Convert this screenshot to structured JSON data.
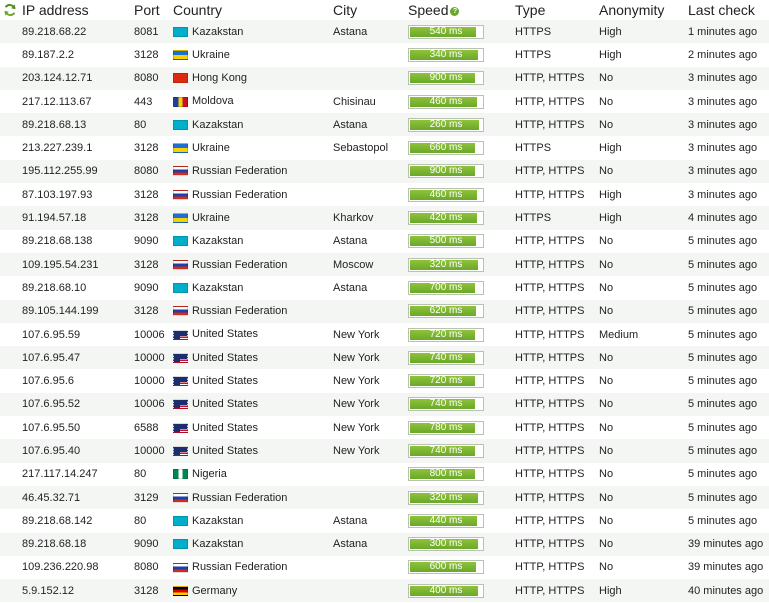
{
  "headers": {
    "ip": "IP address",
    "port": "Port",
    "country": "Country",
    "city": "City",
    "speed": "Speed",
    "type": "Type",
    "anonymity": "Anonymity",
    "last_check": "Last check"
  },
  "colors": {
    "speed_fill": "#6aa82a",
    "speed_border": "#b9c1b3",
    "row_alt": "#f4f6f4"
  },
  "rows": [
    {
      "ip": "89.218.68.22",
      "port": "8081",
      "country": "Kazakstan",
      "flag": "kz",
      "city": "Astana",
      "speed": "540 ms",
      "speed_ratio": 0.92,
      "type": "HTTPS",
      "anonymity": "High",
      "last_check": "1 minutes ago"
    },
    {
      "ip": "89.187.2.2",
      "port": "3128",
      "country": "Ukraine",
      "flag": "ua",
      "city": "",
      "speed": "340 ms",
      "speed_ratio": 0.95,
      "type": "HTTPS",
      "anonymity": "High",
      "last_check": "2 minutes ago"
    },
    {
      "ip": "203.124.12.71",
      "port": "8080",
      "country": "Hong Kong",
      "flag": "hk",
      "city": "",
      "speed": "900 ms",
      "speed_ratio": 0.9,
      "type": "HTTP, HTTPS",
      "anonymity": "No",
      "last_check": "3 minutes ago"
    },
    {
      "ip": "217.12.113.67",
      "port": "443",
      "country": "Moldova",
      "flag": "md",
      "city": "Chisinau",
      "speed": "460 ms",
      "speed_ratio": 0.93,
      "type": "HTTP, HTTPS",
      "anonymity": "No",
      "last_check": "3 minutes ago"
    },
    {
      "ip": "89.218.68.13",
      "port": "80",
      "country": "Kazakstan",
      "flag": "kz",
      "city": "Astana",
      "speed": "260 ms",
      "speed_ratio": 0.96,
      "type": "HTTP, HTTPS",
      "anonymity": "No",
      "last_check": "3 minutes ago"
    },
    {
      "ip": "213.227.239.1",
      "port": "3128",
      "country": "Ukraine",
      "flag": "ua",
      "city": "Sebastopol",
      "speed": "660 ms",
      "speed_ratio": 0.91,
      "type": "HTTPS",
      "anonymity": "High",
      "last_check": "3 minutes ago"
    },
    {
      "ip": "195.112.255.99",
      "port": "8080",
      "country": "Russian Federation",
      "flag": "ru",
      "city": "",
      "speed": "900 ms",
      "speed_ratio": 0.9,
      "type": "HTTP, HTTPS",
      "anonymity": "No",
      "last_check": "3 minutes ago"
    },
    {
      "ip": "87.103.197.93",
      "port": "3128",
      "country": "Russian Federation",
      "flag": "ru",
      "city": "",
      "speed": "460 ms",
      "speed_ratio": 0.93,
      "type": "HTTP, HTTPS",
      "anonymity": "High",
      "last_check": "3 minutes ago"
    },
    {
      "ip": "91.194.57.18",
      "port": "3128",
      "country": "Ukraine",
      "flag": "ua",
      "city": "Kharkov",
      "speed": "420 ms",
      "speed_ratio": 0.93,
      "type": "HTTPS",
      "anonymity": "High",
      "last_check": "4 minutes ago"
    },
    {
      "ip": "89.218.68.138",
      "port": "9090",
      "country": "Kazakstan",
      "flag": "kz",
      "city": "Astana",
      "speed": "500 ms",
      "speed_ratio": 0.92,
      "type": "HTTP, HTTPS",
      "anonymity": "No",
      "last_check": "5 minutes ago"
    },
    {
      "ip": "109.195.54.231",
      "port": "3128",
      "country": "Russian Federation",
      "flag": "ru",
      "city": "Moscow",
      "speed": "320 ms",
      "speed_ratio": 0.95,
      "type": "HTTP, HTTPS",
      "anonymity": "No",
      "last_check": "5 minutes ago"
    },
    {
      "ip": "89.218.68.10",
      "port": "9090",
      "country": "Kazakstan",
      "flag": "kz",
      "city": "Astana",
      "speed": "700 ms",
      "speed_ratio": 0.91,
      "type": "HTTP, HTTPS",
      "anonymity": "No",
      "last_check": "5 minutes ago"
    },
    {
      "ip": "89.105.144.199",
      "port": "3128",
      "country": "Russian Federation",
      "flag": "ru",
      "city": "",
      "speed": "620 ms",
      "speed_ratio": 0.92,
      "type": "HTTP, HTTPS",
      "anonymity": "No",
      "last_check": "5 minutes ago"
    },
    {
      "ip": "107.6.95.59",
      "port": "10006",
      "country": "United States",
      "flag": "us",
      "city": "New York",
      "speed": "720 ms",
      "speed_ratio": 0.91,
      "type": "HTTP, HTTPS",
      "anonymity": "Medium",
      "last_check": "5 minutes ago"
    },
    {
      "ip": "107.6.95.47",
      "port": "10000",
      "country": "United States",
      "flag": "us",
      "city": "New York",
      "speed": "740 ms",
      "speed_ratio": 0.91,
      "type": "HTTP, HTTPS",
      "anonymity": "No",
      "last_check": "5 minutes ago"
    },
    {
      "ip": "107.6.95.6",
      "port": "10000",
      "country": "United States",
      "flag": "us",
      "city": "New York",
      "speed": "720 ms",
      "speed_ratio": 0.91,
      "type": "HTTP, HTTPS",
      "anonymity": "No",
      "last_check": "5 minutes ago"
    },
    {
      "ip": "107.6.95.52",
      "port": "10006",
      "country": "United States",
      "flag": "us",
      "city": "New York",
      "speed": "740 ms",
      "speed_ratio": 0.91,
      "type": "HTTP, HTTPS",
      "anonymity": "No",
      "last_check": "5 minutes ago"
    },
    {
      "ip": "107.6.95.50",
      "port": "6588",
      "country": "United States",
      "flag": "us",
      "city": "New York",
      "speed": "780 ms",
      "speed_ratio": 0.9,
      "type": "HTTP, HTTPS",
      "anonymity": "No",
      "last_check": "5 minutes ago"
    },
    {
      "ip": "107.6.95.40",
      "port": "10000",
      "country": "United States",
      "flag": "us",
      "city": "New York",
      "speed": "740 ms",
      "speed_ratio": 0.91,
      "type": "HTTP, HTTPS",
      "anonymity": "No",
      "last_check": "5 minutes ago"
    },
    {
      "ip": "217.117.14.247",
      "port": "80",
      "country": "Nigeria",
      "flag": "ng",
      "city": "",
      "speed": "800 ms",
      "speed_ratio": 0.9,
      "type": "HTTP, HTTPS",
      "anonymity": "No",
      "last_check": "5 minutes ago"
    },
    {
      "ip": "46.45.32.71",
      "port": "3129",
      "country": "Russian Federation",
      "flag": "ru",
      "city": "",
      "speed": "320 ms",
      "speed_ratio": 0.95,
      "type": "HTTP, HTTPS",
      "anonymity": "No",
      "last_check": "5 minutes ago"
    },
    {
      "ip": "89.218.68.142",
      "port": "80",
      "country": "Kazakstan",
      "flag": "kz",
      "city": "Astana",
      "speed": "440 ms",
      "speed_ratio": 0.93,
      "type": "HTTP, HTTPS",
      "anonymity": "No",
      "last_check": "5 minutes ago"
    },
    {
      "ip": "89.218.68.18",
      "port": "9090",
      "country": "Kazakstan",
      "flag": "kz",
      "city": "Astana",
      "speed": "300 ms",
      "speed_ratio": 0.95,
      "type": "HTTP, HTTPS",
      "anonymity": "No",
      "last_check": "39 minutes ago"
    },
    {
      "ip": "109.236.220.98",
      "port": "8080",
      "country": "Russian Federation",
      "flag": "ru",
      "city": "",
      "speed": "600 ms",
      "speed_ratio": 0.92,
      "type": "HTTP, HTTPS",
      "anonymity": "No",
      "last_check": "39 minutes ago"
    },
    {
      "ip": "5.9.152.12",
      "port": "3128",
      "country": "Germany",
      "flag": "de",
      "city": "",
      "speed": "400 ms",
      "speed_ratio": 0.94,
      "type": "HTTP, HTTPS",
      "anonymity": "High",
      "last_check": "40 minutes ago"
    }
  ]
}
